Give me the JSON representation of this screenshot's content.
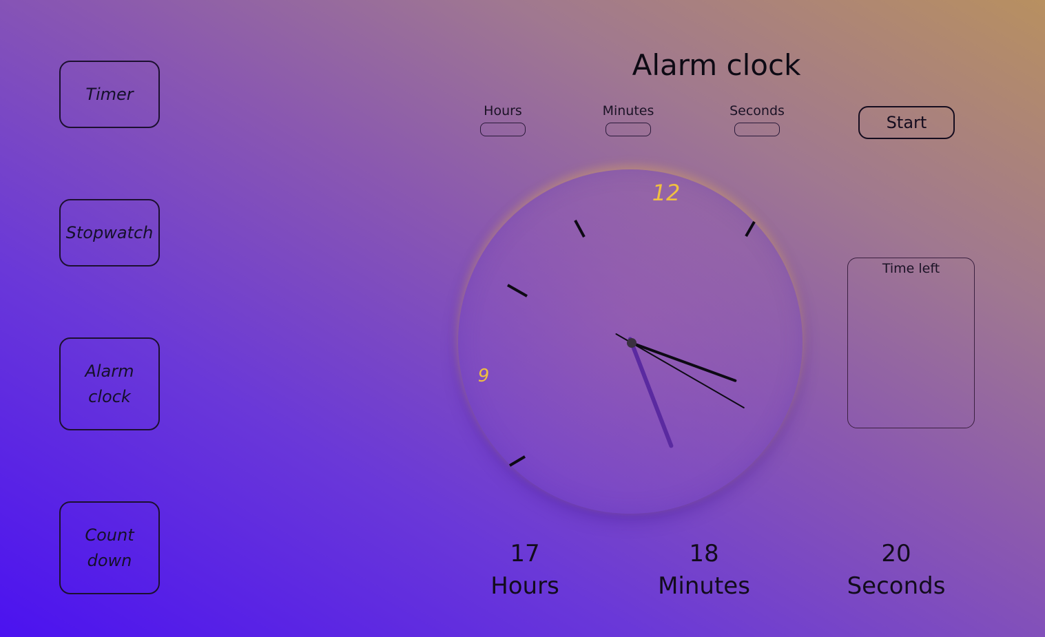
{
  "nav": {
    "timer": "Timer",
    "stopwatch": "Stopwatch",
    "alarm_line1": "Alarm",
    "alarm_line2": "clock",
    "countdown_line1": "Count",
    "countdown_line2": "down"
  },
  "page": {
    "title": "Alarm clock"
  },
  "inputs": {
    "hours_label": "Hours",
    "minutes_label": "Minutes",
    "seconds_label": "Seconds"
  },
  "controls": {
    "start_label": "Start"
  },
  "clock": {
    "numeral_12": "12",
    "numeral_9": "9",
    "numeral_color": "#f0c040",
    "hour_hand_color": "#5a2aa0",
    "hand_color": "#0d0a14",
    "hours": 17,
    "minutes": 18,
    "seconds": 20
  },
  "panel": {
    "time_left_label": "Time left"
  },
  "readout": {
    "hours_value": "17",
    "hours_unit": "Hours",
    "minutes_value": "18",
    "minutes_unit": "Minutes",
    "seconds_value": "20",
    "seconds_unit": "Seconds"
  }
}
